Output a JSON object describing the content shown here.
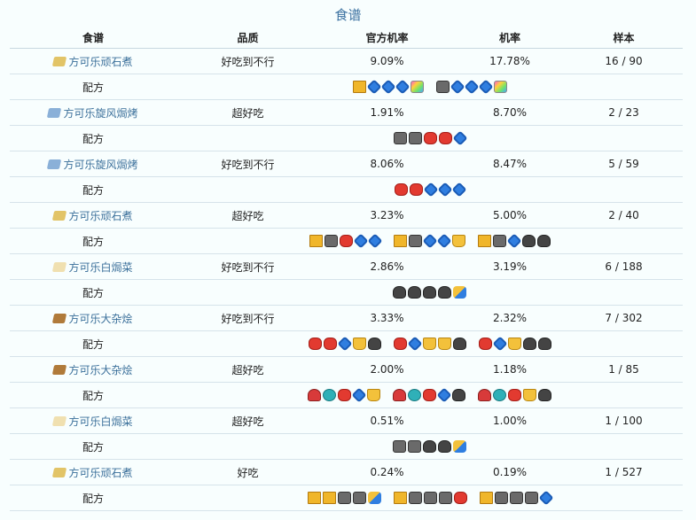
{
  "caption": "食谱",
  "headers": {
    "name": "食谱",
    "quality": "品质",
    "official": "官方机率",
    "rate": "机率",
    "samples": "样本"
  },
  "recipe_label": "配方",
  "rows": [
    {
      "name": "方可乐顽石煮",
      "icon_color": "#e2c467",
      "quality": "好吃到不行",
      "official": "9.09%",
      "rate": "17.78%",
      "samples": "16 / 90",
      "combos": [
        [
          "gold",
          "blue",
          "blue",
          "blue",
          "rainbow"
        ],
        [
          "gray",
          "blue",
          "blue",
          "blue",
          "rainbow"
        ]
      ]
    },
    {
      "name": "方可乐旋风焗烤",
      "icon_color": "#8ab0d8",
      "quality": "超好吃",
      "official": "1.91%",
      "rate": "8.70%",
      "samples": "2 / 23",
      "combos": [
        [
          "gray",
          "gray",
          "red",
          "red",
          "blue"
        ]
      ]
    },
    {
      "name": "方可乐旋风焗烤",
      "icon_color": "#8ab0d8",
      "quality": "好吃到不行",
      "official": "8.06%",
      "rate": "8.47%",
      "samples": "5 / 59",
      "combos": [
        [
          "red",
          "red",
          "blue",
          "blue",
          "blue"
        ]
      ]
    },
    {
      "name": "方可乐顽石煮",
      "icon_color": "#e2c467",
      "quality": "超好吃",
      "official": "3.23%",
      "rate": "5.00%",
      "samples": "2 / 40",
      "combos": [
        [
          "gold",
          "gray",
          "red",
          "blue",
          "blue"
        ],
        [
          "gold",
          "gray",
          "blue",
          "blue",
          "yellow"
        ],
        [
          "gold",
          "gray",
          "blue",
          "dark",
          "dark"
        ]
      ]
    },
    {
      "name": "方可乐白焗菜",
      "icon_color": "#f0e0b0",
      "quality": "好吃到不行",
      "official": "2.86%",
      "rate": "3.19%",
      "samples": "6 / 188",
      "combos": [
        [
          "dark",
          "dark",
          "dark",
          "dark",
          "mixed"
        ]
      ]
    },
    {
      "name": "方可乐大杂烩",
      "icon_color": "#b07a3a",
      "quality": "好吃到不行",
      "official": "3.33%",
      "rate": "2.32%",
      "samples": "7 / 302",
      "combos": [
        [
          "red",
          "red",
          "blue",
          "yellow",
          "dark"
        ],
        [
          "red",
          "blue",
          "yellow",
          "yellow",
          "dark"
        ],
        [
          "red",
          "blue",
          "yellow",
          "dark",
          "dark"
        ]
      ]
    },
    {
      "name": "方可乐大杂烩",
      "icon_color": "#b07a3a",
      "quality": "超好吃",
      "official": "2.00%",
      "rate": "1.18%",
      "samples": "1 / 85",
      "combos": [
        [
          "mush",
          "teal",
          "red",
          "blue",
          "yellow"
        ],
        [
          "mush",
          "teal",
          "red",
          "blue",
          "dark"
        ],
        [
          "mush",
          "teal",
          "red",
          "yellow",
          "dark"
        ]
      ]
    },
    {
      "name": "方可乐白焗菜",
      "icon_color": "#f0e0b0",
      "quality": "超好吃",
      "official": "0.51%",
      "rate": "1.00%",
      "samples": "1 / 100",
      "combos": [
        [
          "gray",
          "gray",
          "dark",
          "dark",
          "mixed"
        ]
      ]
    },
    {
      "name": "方可乐顽石煮",
      "icon_color": "#e2c467",
      "quality": "好吃",
      "official": "0.24%",
      "rate": "0.19%",
      "samples": "1 / 527",
      "combos": [
        [
          "gold",
          "gold",
          "gray",
          "gray",
          "mixed"
        ],
        [
          "gold",
          "gray",
          "gray",
          "gray",
          "red"
        ],
        [
          "gold",
          "gray",
          "gray",
          "gray",
          "blue"
        ]
      ]
    }
  ],
  "colors": {
    "link": "#3a6f9a",
    "caption": "#3a70a0",
    "border": "#d6e3ea"
  }
}
